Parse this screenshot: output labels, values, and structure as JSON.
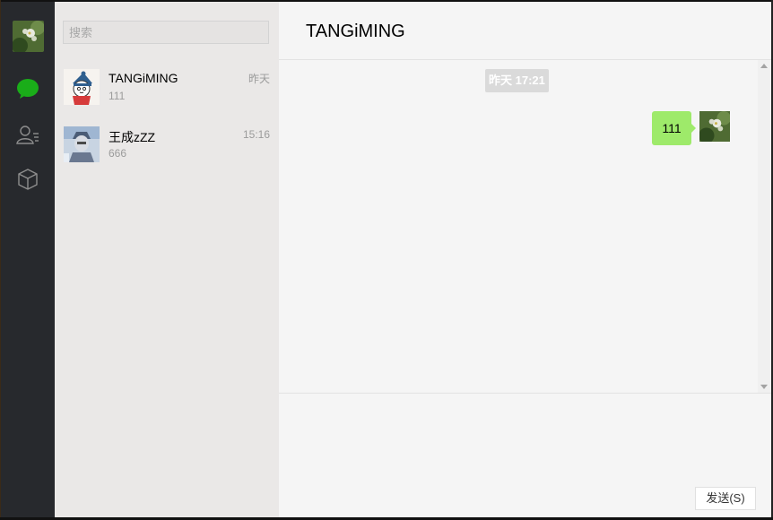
{
  "colors": {
    "rail_bg": "#27292d",
    "list_bg": "#eae8e7",
    "chat_bg": "#f5f5f5",
    "bubble_green": "#9eea6a",
    "active_icon": "#1aad19",
    "inactive_icon": "#8e8e8e"
  },
  "rail": {
    "avatar_icon": "flower-avatar",
    "items": [
      {
        "icon": "chat-icon",
        "active": true
      },
      {
        "icon": "contacts-icon",
        "active": false
      },
      {
        "icon": "collections-icon",
        "active": false
      }
    ]
  },
  "search": {
    "placeholder": "搜索",
    "value": ""
  },
  "conversations": [
    {
      "name": "TANGiMING",
      "time": "昨天",
      "last_message": "111",
      "avatar_icon": "cartoon-avatar"
    },
    {
      "name": "王成zZZ",
      "time": "15:16",
      "last_message": "666",
      "avatar_icon": "photo-avatar"
    }
  ],
  "chat": {
    "title": "TANGiMING",
    "timestamp": "昨天 17:21",
    "messages": [
      {
        "text": "111",
        "from_me": true
      }
    ],
    "send_label": "发送(S)"
  }
}
